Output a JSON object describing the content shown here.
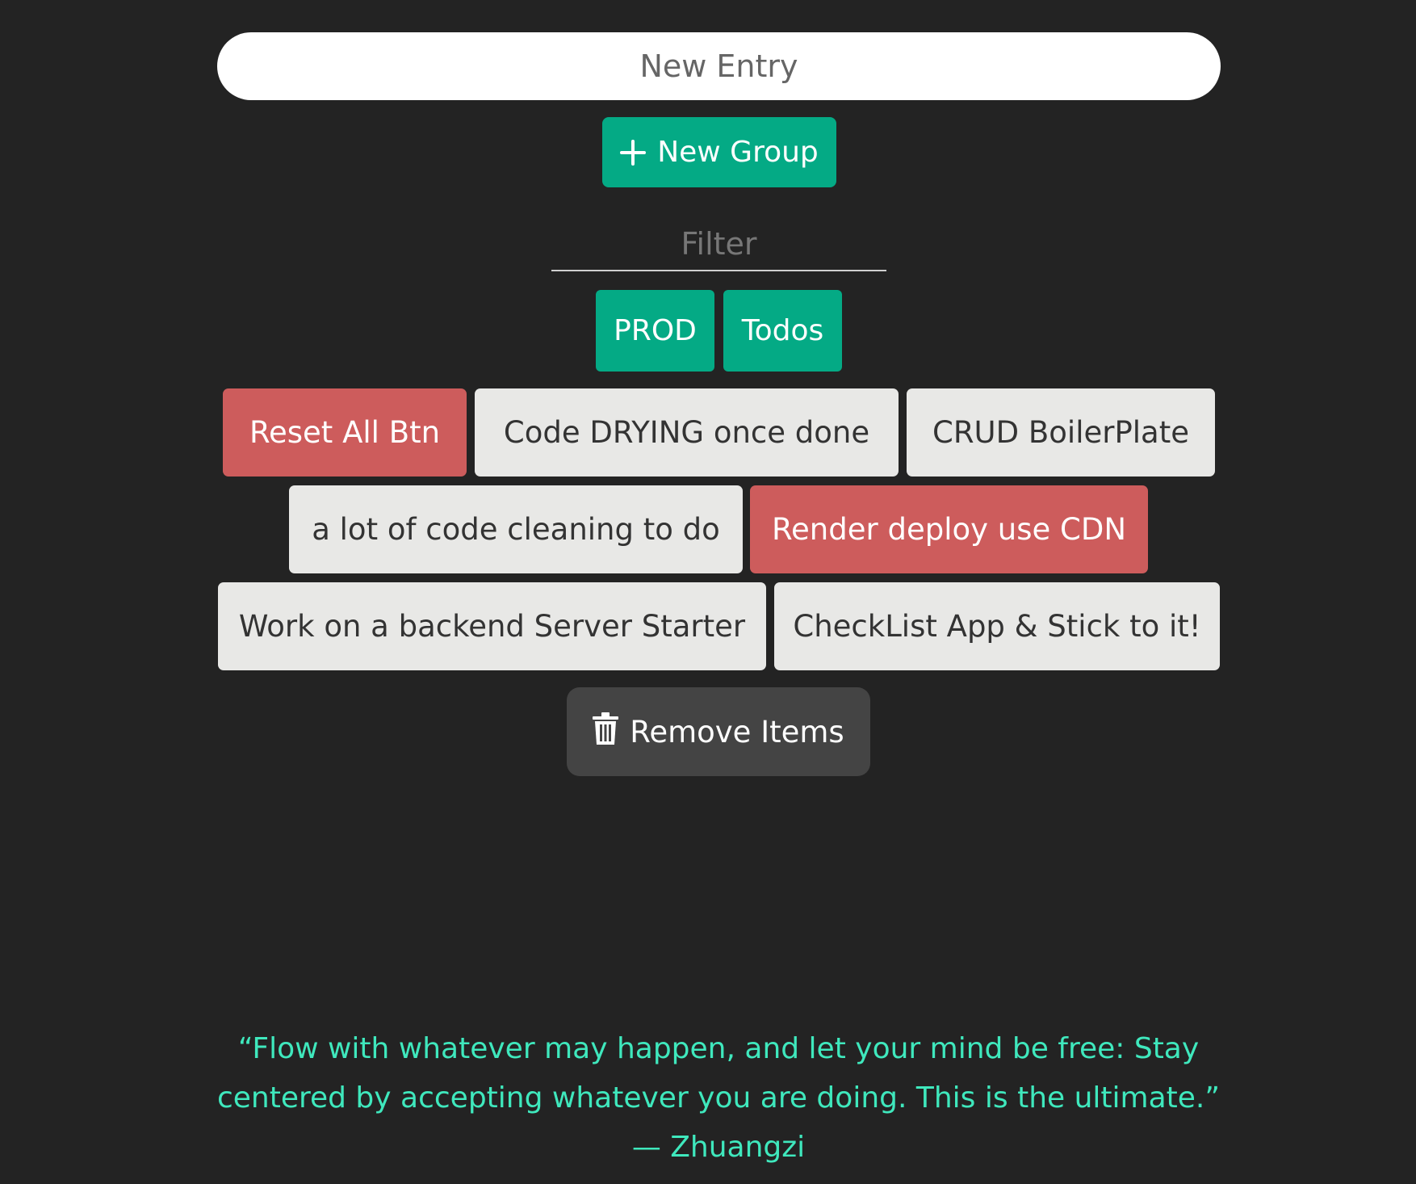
{
  "entry": {
    "placeholder": "New Entry"
  },
  "new_group": {
    "label": "New Group"
  },
  "filter": {
    "placeholder": "Filter"
  },
  "groups": [
    {
      "label": "PROD"
    },
    {
      "label": "Todos"
    }
  ],
  "items": [
    {
      "label": "Reset All Btn",
      "state": "done"
    },
    {
      "label": "Code DRYING once done",
      "state": "pending"
    },
    {
      "label": "CRUD BoilerPlate",
      "state": "pending"
    },
    {
      "label": "a lot of code cleaning to do",
      "state": "pending"
    },
    {
      "label": "Render deploy use CDN",
      "state": "done"
    },
    {
      "label": "Work on a backend Server Starter",
      "state": "pending"
    },
    {
      "label": "CheckList App & Stick to it!",
      "state": "pending"
    }
  ],
  "remove": {
    "label": "Remove Items"
  },
  "quote": {
    "text": "“Flow with whatever may happen, and let your mind be free: Stay centered by accepting whatever you are doing. This is the ultimate.”",
    "author": "— Zhuangzi"
  },
  "colors": {
    "background": "#232323",
    "accent_green": "#04aa85",
    "done_red": "#cd5c5c",
    "item_gray": "#e8e8e6",
    "quote_teal": "#3fe8bd"
  }
}
